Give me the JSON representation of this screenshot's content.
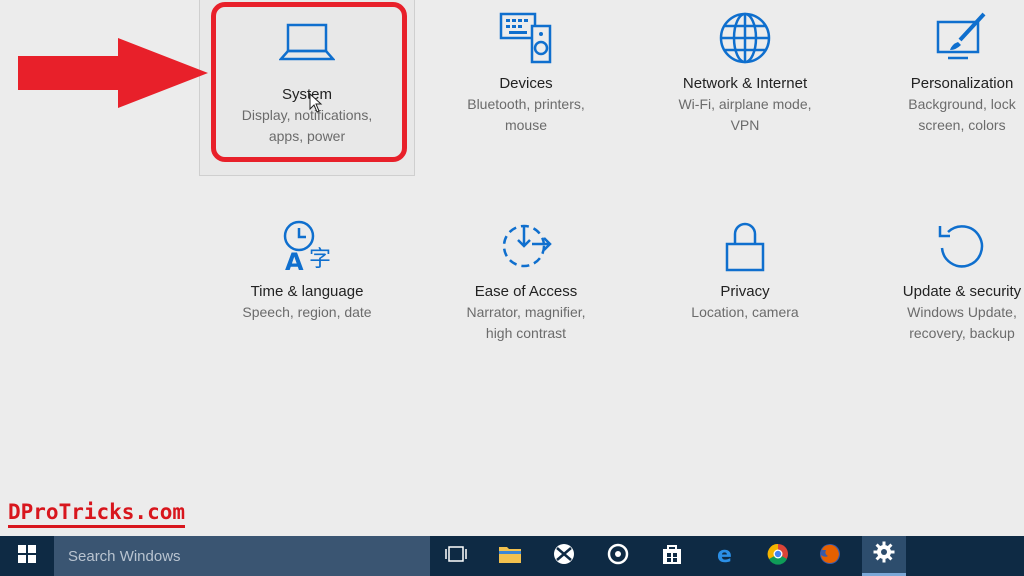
{
  "tiles": [
    {
      "id": "system",
      "icon": "laptop-icon",
      "title": "System",
      "desc": [
        "Display, notifications,",
        "apps, power"
      ]
    },
    {
      "id": "devices",
      "icon": "devices-icon",
      "title": "Devices",
      "desc": [
        "Bluetooth, printers,",
        "mouse"
      ]
    },
    {
      "id": "network",
      "icon": "globe-icon",
      "title": "Network & Internet",
      "desc": [
        "Wi-Fi, airplane mode,",
        "VPN"
      ]
    },
    {
      "id": "personalization",
      "icon": "personalization-icon",
      "title": "Personalization",
      "desc": [
        "Background, lock",
        "screen, colors"
      ]
    },
    {
      "id": "time",
      "icon": "time-language-icon",
      "title": "Time & language",
      "desc": [
        "Speech, region, date"
      ]
    },
    {
      "id": "ease",
      "icon": "ease-of-access-icon",
      "title": "Ease of Access",
      "desc": [
        "Narrator, magnifier,",
        "high contrast"
      ]
    },
    {
      "id": "privacy",
      "icon": "lock-icon",
      "title": "Privacy",
      "desc": [
        "Location, camera"
      ]
    },
    {
      "id": "update",
      "icon": "update-icon",
      "title": "Update & security",
      "desc": [
        "Windows Update,",
        "recovery, backup"
      ]
    }
  ],
  "watermark": "DProTricks.com",
  "taskbar": {
    "search_placeholder": "Search Windows",
    "icons": [
      "windows-start-icon",
      "task-view-icon",
      "file-explorer-icon",
      "xbox-icon",
      "groove-music-icon",
      "store-icon",
      "edge-icon",
      "chrome-icon",
      "firefox-icon",
      "settings-gear-icon"
    ]
  },
  "colors": {
    "accent": "#0f6fce",
    "highlight": "#e8202a",
    "taskbar": "#0e2a44"
  }
}
